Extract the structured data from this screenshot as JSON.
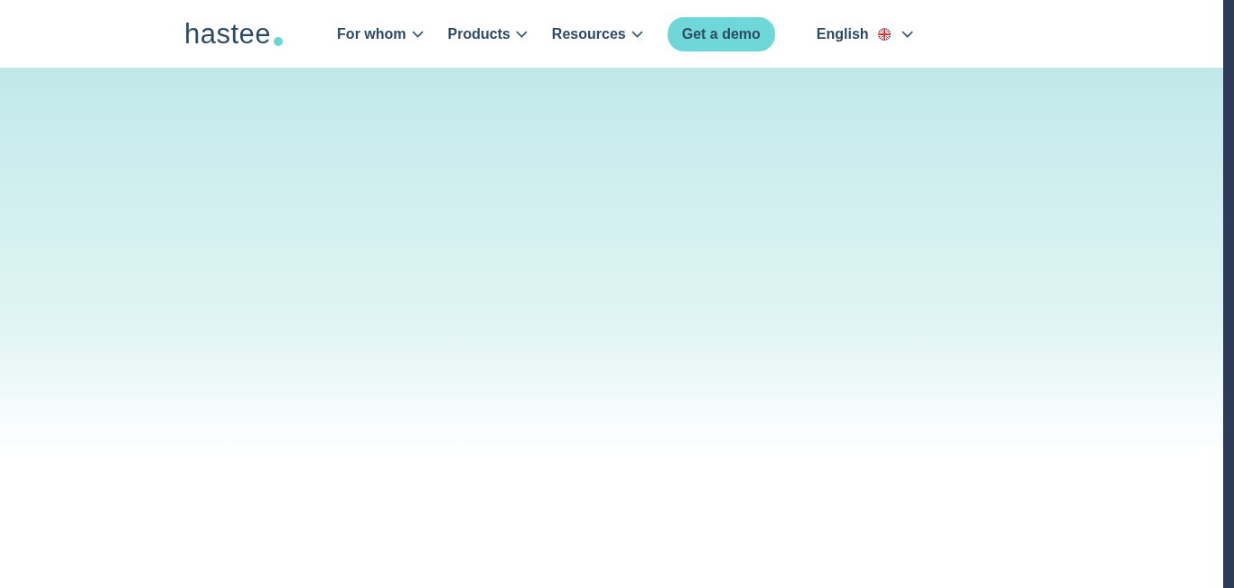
{
  "logo": {
    "text": "hastee"
  },
  "nav": {
    "items": [
      {
        "label": "For whom",
        "dropdown": true
      },
      {
        "label": "Products",
        "dropdown": true
      },
      {
        "label": "Resources",
        "dropdown": true
      }
    ],
    "cta": "Get a demo",
    "language": {
      "label": "English",
      "dropdown": true
    }
  }
}
